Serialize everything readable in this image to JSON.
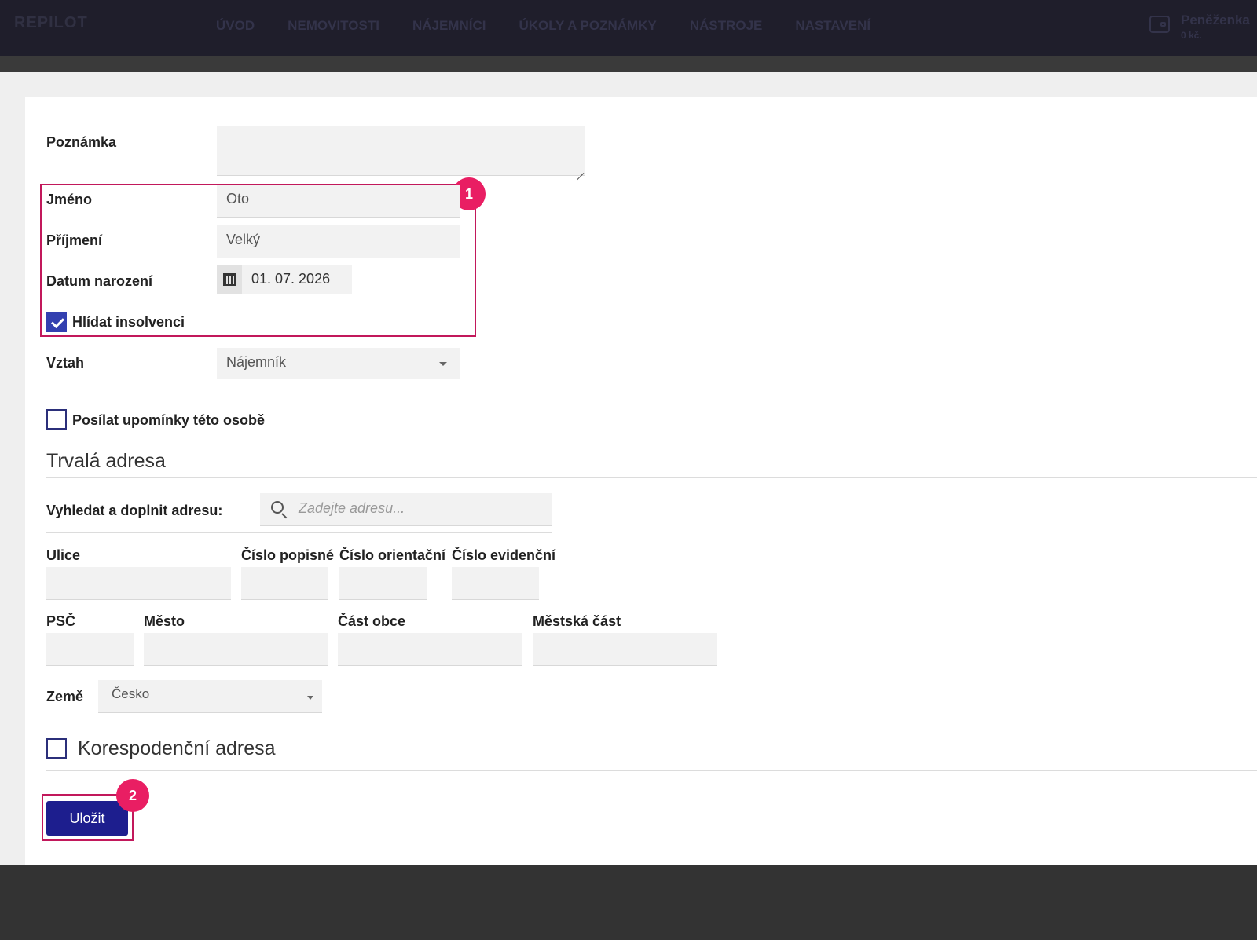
{
  "header": {
    "logo": "REPILOT",
    "nav": [
      "ÚVOD",
      "NEMOVITOSTI",
      "NÁJEMNÍCI",
      "ÚKOLY A POZNÁMKY",
      "NÁSTROJE",
      "NASTAVENÍ"
    ],
    "wallet": {
      "title": "Peněženka",
      "amount": "0 kč."
    }
  },
  "form": {
    "note": {
      "label": "Poznámka",
      "value": ""
    },
    "first_name": {
      "label": "Jméno",
      "value": "Oto"
    },
    "last_name": {
      "label": "Příjmení",
      "value": "Velký"
    },
    "birth_date": {
      "label": "Datum narození",
      "value": "01. 07. 2026"
    },
    "watch_insolvency": {
      "label": "Hlídat insolvenci",
      "checked": true
    },
    "relation": {
      "label": "Vztah",
      "value": "Nájemník"
    },
    "send_reminders": {
      "label": "Posílat upomínky této osobě",
      "checked": false
    }
  },
  "permanent_address": {
    "title": "Trvalá adresa",
    "search": {
      "label": "Vyhledat a doplnit adresu:",
      "placeholder": "Zadejte adresu..."
    },
    "street": {
      "label": "Ulice",
      "value": ""
    },
    "house_number": {
      "label": "Číslo popisné",
      "value": ""
    },
    "orientation_number": {
      "label": "Číslo orientační",
      "value": ""
    },
    "registration_number": {
      "label": "Číslo evidenční",
      "value": ""
    },
    "zip": {
      "label": "PSČ",
      "value": ""
    },
    "city": {
      "label": "Město",
      "value": ""
    },
    "municipality_part": {
      "label": "Část obce",
      "value": ""
    },
    "city_district": {
      "label": "Městská část",
      "value": ""
    },
    "country": {
      "label": "Země",
      "value": "Česko"
    }
  },
  "correspondence_address": {
    "label": "Korespodenční adresa",
    "checked": false
  },
  "actions": {
    "save": "Uložit"
  },
  "annotations": {
    "badge1": "1",
    "badge2": "2",
    "highlight_color": "#e91e63"
  },
  "colors": {
    "topbar": "#1f1e2b",
    "primary": "#1d1e8e",
    "checkbox": "#3340b0"
  }
}
